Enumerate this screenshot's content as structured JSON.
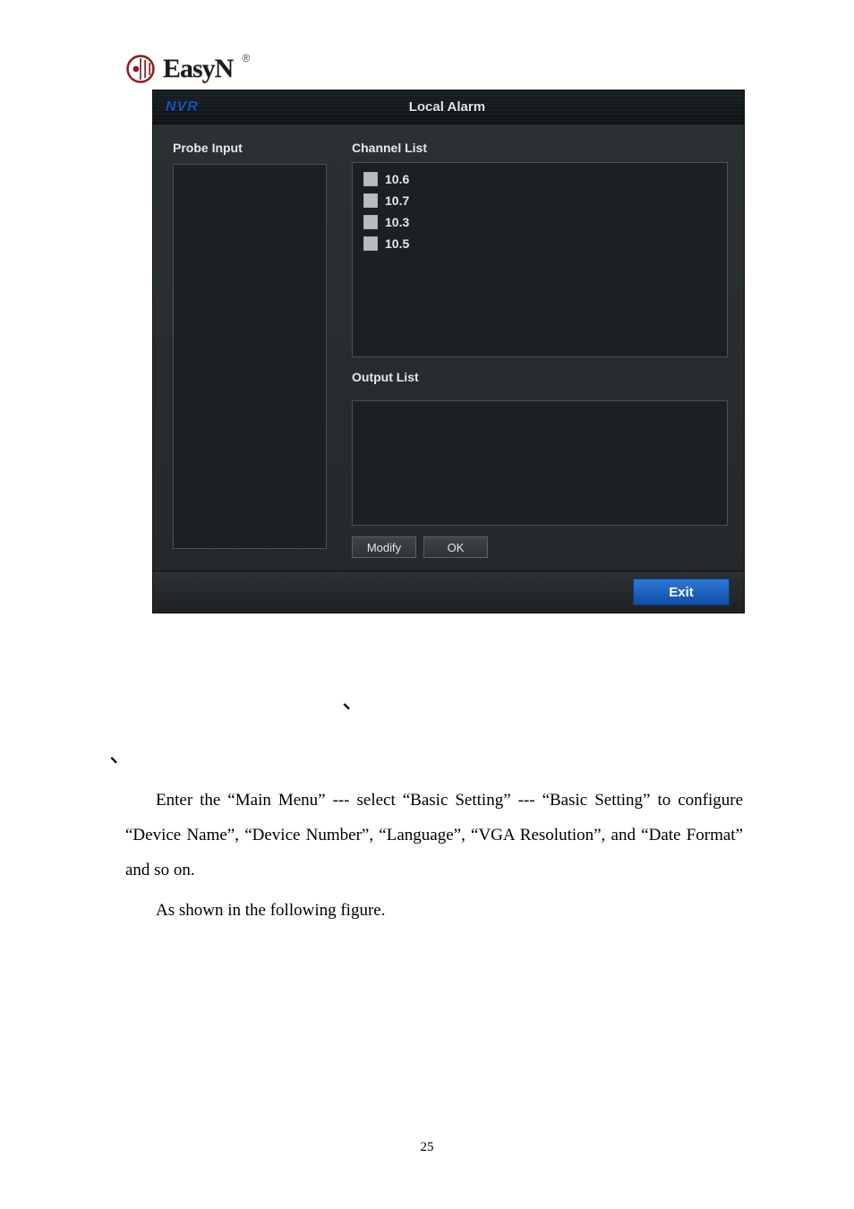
{
  "logo": {
    "brand_text": "EasyN",
    "registered": "®"
  },
  "window": {
    "brand": "NVR",
    "title": "Local Alarm",
    "left_label": "Probe Input",
    "channel_label": "Channel List",
    "output_label": "Output List",
    "channels": [
      "10.6",
      "10.7",
      "10.3",
      "10.5"
    ],
    "buttons": {
      "modify": "Modify",
      "ok": "OK",
      "exit": "Exit"
    }
  },
  "ticks": {
    "t1": "、",
    "t2": "、"
  },
  "body": {
    "p1": "Enter the “Main Menu” --- select “Basic Setting” --- “Basic Setting” to configure “Device Name”, “Device Number”, “Language”, “VGA Resolution”, and “Date Format” and so on.",
    "p2": "As shown in the following figure."
  },
  "page_number": "25"
}
